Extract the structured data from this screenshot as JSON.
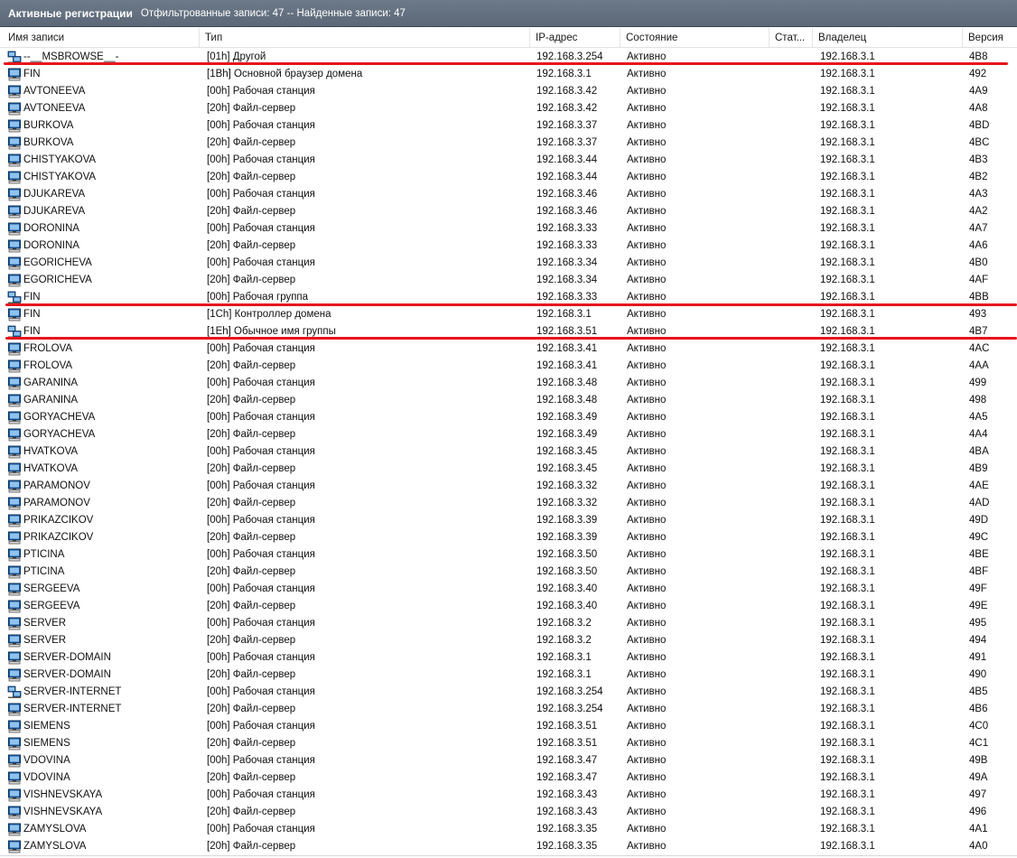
{
  "window": {
    "title": "Активные регистрации",
    "info": "Отфильтрованные записи: 47 -- Найденные записи: 47"
  },
  "columns": {
    "name": "Имя записи",
    "type": "Тип",
    "ip": "IP-адрес",
    "state": "Состояние",
    "static": "Стат...",
    "owner": "Владелец",
    "version": "Версия"
  },
  "colors": {
    "accent_line": "#e8141c",
    "header_bg": "#5f6b7a"
  },
  "rows": [
    {
      "icon": "group-icon",
      "name": "--__MSBROWSE__-",
      "type": "[01h] Другой",
      "ip": "192.168.3.254",
      "state": "Активно",
      "owner": "192.168.3.1",
      "version": "4B8"
    },
    {
      "icon": "computer-icon",
      "name": "FIN",
      "type": "[1Bh] Основной браузер домена",
      "ip": "192.168.3.1",
      "state": "Активно",
      "owner": "192.168.3.1",
      "version": "492"
    },
    {
      "icon": "computer-icon",
      "name": "AVTONEEVA",
      "type": "[00h] Рабочая станция",
      "ip": "192.168.3.42",
      "state": "Активно",
      "owner": "192.168.3.1",
      "version": "4A9"
    },
    {
      "icon": "computer-icon",
      "name": "AVTONEEVA",
      "type": "[20h] Файл-сервер",
      "ip": "192.168.3.42",
      "state": "Активно",
      "owner": "192.168.3.1",
      "version": "4A8"
    },
    {
      "icon": "computer-icon",
      "name": "BURKOVA",
      "type": "[00h] Рабочая станция",
      "ip": "192.168.3.37",
      "state": "Активно",
      "owner": "192.168.3.1",
      "version": "4BD"
    },
    {
      "icon": "computer-icon",
      "name": "BURKOVA",
      "type": "[20h] Файл-сервер",
      "ip": "192.168.3.37",
      "state": "Активно",
      "owner": "192.168.3.1",
      "version": "4BC"
    },
    {
      "icon": "computer-icon",
      "name": "CHISTYAKOVA",
      "type": "[00h] Рабочая станция",
      "ip": "192.168.3.44",
      "state": "Активно",
      "owner": "192.168.3.1",
      "version": "4B3"
    },
    {
      "icon": "computer-icon",
      "name": "CHISTYAKOVA",
      "type": "[20h] Файл-сервер",
      "ip": "192.168.3.44",
      "state": "Активно",
      "owner": "192.168.3.1",
      "version": "4B2"
    },
    {
      "icon": "computer-icon",
      "name": "DJUKAREVA",
      "type": "[00h] Рабочая станция",
      "ip": "192.168.3.46",
      "state": "Активно",
      "owner": "192.168.3.1",
      "version": "4A3"
    },
    {
      "icon": "computer-icon",
      "name": "DJUKAREVA",
      "type": "[20h] Файл-сервер",
      "ip": "192.168.3.46",
      "state": "Активно",
      "owner": "192.168.3.1",
      "version": "4A2"
    },
    {
      "icon": "computer-icon",
      "name": "DORONINA",
      "type": "[00h] Рабочая станция",
      "ip": "192.168.3.33",
      "state": "Активно",
      "owner": "192.168.3.1",
      "version": "4A7"
    },
    {
      "icon": "computer-icon",
      "name": "DORONINA",
      "type": "[20h] Файл-сервер",
      "ip": "192.168.3.33",
      "state": "Активно",
      "owner": "192.168.3.1",
      "version": "4A6"
    },
    {
      "icon": "computer-icon",
      "name": "EGORICHEVA",
      "type": "[00h] Рабочая станция",
      "ip": "192.168.3.34",
      "state": "Активно",
      "owner": "192.168.3.1",
      "version": "4B0"
    },
    {
      "icon": "computer-icon",
      "name": "EGORICHEVA",
      "type": "[20h] Файл-сервер",
      "ip": "192.168.3.34",
      "state": "Активно",
      "owner": "192.168.3.1",
      "version": "4AF"
    },
    {
      "icon": "group-icon",
      "name": "FIN",
      "type": "[00h] Рабочая группа",
      "ip": "192.168.3.33",
      "state": "Активно",
      "owner": "192.168.3.1",
      "version": "4BB"
    },
    {
      "icon": "computer-icon",
      "name": "FIN",
      "type": "[1Ch] Контроллер домена",
      "ip": "192.168.3.1",
      "state": "Активно",
      "owner": "192.168.3.1",
      "version": "493"
    },
    {
      "icon": "group-icon",
      "name": "FIN",
      "type": "[1Eh] Обычное имя группы",
      "ip": "192.168.3.51",
      "state": "Активно",
      "owner": "192.168.3.1",
      "version": "4B7"
    },
    {
      "icon": "computer-icon",
      "name": "FROLOVA",
      "type": "[00h] Рабочая станция",
      "ip": "192.168.3.41",
      "state": "Активно",
      "owner": "192.168.3.1",
      "version": "4AC"
    },
    {
      "icon": "computer-icon",
      "name": "FROLOVA",
      "type": "[20h] Файл-сервер",
      "ip": "192.168.3.41",
      "state": "Активно",
      "owner": "192.168.3.1",
      "version": "4AA"
    },
    {
      "icon": "computer-icon",
      "name": "GARANINA",
      "type": "[00h] Рабочая станция",
      "ip": "192.168.3.48",
      "state": "Активно",
      "owner": "192.168.3.1",
      "version": "499"
    },
    {
      "icon": "computer-icon",
      "name": "GARANINA",
      "type": "[20h] Файл-сервер",
      "ip": "192.168.3.48",
      "state": "Активно",
      "owner": "192.168.3.1",
      "version": "498"
    },
    {
      "icon": "computer-icon",
      "name": "GORYACHEVA",
      "type": "[00h] Рабочая станция",
      "ip": "192.168.3.49",
      "state": "Активно",
      "owner": "192.168.3.1",
      "version": "4A5"
    },
    {
      "icon": "computer-icon",
      "name": "GORYACHEVA",
      "type": "[20h] Файл-сервер",
      "ip": "192.168.3.49",
      "state": "Активно",
      "owner": "192.168.3.1",
      "version": "4A4"
    },
    {
      "icon": "computer-icon",
      "name": "HVATKOVA",
      "type": "[00h] Рабочая станция",
      "ip": "192.168.3.45",
      "state": "Активно",
      "owner": "192.168.3.1",
      "version": "4BA"
    },
    {
      "icon": "computer-icon",
      "name": "HVATKOVA",
      "type": "[20h] Файл-сервер",
      "ip": "192.168.3.45",
      "state": "Активно",
      "owner": "192.168.3.1",
      "version": "4B9"
    },
    {
      "icon": "computer-icon",
      "name": "PARAMONOV",
      "type": "[00h] Рабочая станция",
      "ip": "192.168.3.32",
      "state": "Активно",
      "owner": "192.168.3.1",
      "version": "4AE"
    },
    {
      "icon": "computer-icon",
      "name": "PARAMONOV",
      "type": "[20h] Файл-сервер",
      "ip": "192.168.3.32",
      "state": "Активно",
      "owner": "192.168.3.1",
      "version": "4AD"
    },
    {
      "icon": "computer-icon",
      "name": "PRIKAZCIKOV",
      "type": "[00h] Рабочая станция",
      "ip": "192.168.3.39",
      "state": "Активно",
      "owner": "192.168.3.1",
      "version": "49D"
    },
    {
      "icon": "computer-icon",
      "name": "PRIKAZCIKOV",
      "type": "[20h] Файл-сервер",
      "ip": "192.168.3.39",
      "state": "Активно",
      "owner": "192.168.3.1",
      "version": "49C"
    },
    {
      "icon": "computer-icon",
      "name": "PTICINA",
      "type": "[00h] Рабочая станция",
      "ip": "192.168.3.50",
      "state": "Активно",
      "owner": "192.168.3.1",
      "version": "4BE"
    },
    {
      "icon": "computer-icon",
      "name": "PTICINA",
      "type": "[20h] Файл-сервер",
      "ip": "192.168.3.50",
      "state": "Активно",
      "owner": "192.168.3.1",
      "version": "4BF"
    },
    {
      "icon": "computer-icon",
      "name": "SERGEEVA",
      "type": "[00h] Рабочая станция",
      "ip": "192.168.3.40",
      "state": "Активно",
      "owner": "192.168.3.1",
      "version": "49F"
    },
    {
      "icon": "computer-icon",
      "name": "SERGEEVA",
      "type": "[20h] Файл-сервер",
      "ip": "192.168.3.40",
      "state": "Активно",
      "owner": "192.168.3.1",
      "version": "49E"
    },
    {
      "icon": "computer-icon",
      "name": "SERVER",
      "type": "[00h] Рабочая станция",
      "ip": "192.168.3.2",
      "state": "Активно",
      "owner": "192.168.3.1",
      "version": "495"
    },
    {
      "icon": "computer-icon",
      "name": "SERVER",
      "type": "[20h] Файл-сервер",
      "ip": "192.168.3.2",
      "state": "Активно",
      "owner": "192.168.3.1",
      "version": "494"
    },
    {
      "icon": "computer-icon",
      "name": "SERVER-DOMAIN",
      "type": "[00h] Рабочая станция",
      "ip": "192.168.3.1",
      "state": "Активно",
      "owner": "192.168.3.1",
      "version": "491"
    },
    {
      "icon": "computer-icon",
      "name": "SERVER-DOMAIN",
      "type": "[20h] Файл-сервер",
      "ip": "192.168.3.1",
      "state": "Активно",
      "owner": "192.168.3.1",
      "version": "490"
    },
    {
      "icon": "group-icon",
      "name": "SERVER-INTERNET",
      "type": "[00h] Рабочая станция",
      "ip": "192.168.3.254",
      "state": "Активно",
      "owner": "192.168.3.1",
      "version": "4B5"
    },
    {
      "icon": "computer-icon",
      "name": "SERVER-INTERNET",
      "type": "[20h] Файл-сервер",
      "ip": "192.168.3.254",
      "state": "Активно",
      "owner": "192.168.3.1",
      "version": "4B6"
    },
    {
      "icon": "computer-icon",
      "name": "SIEMENS",
      "type": "[00h] Рабочая станция",
      "ip": "192.168.3.51",
      "state": "Активно",
      "owner": "192.168.3.1",
      "version": "4C0"
    },
    {
      "icon": "computer-icon",
      "name": "SIEMENS",
      "type": "[20h] Файл-сервер",
      "ip": "192.168.3.51",
      "state": "Активно",
      "owner": "192.168.3.1",
      "version": "4C1"
    },
    {
      "icon": "computer-icon",
      "name": "VDOVINA",
      "type": "[00h] Рабочая станция",
      "ip": "192.168.3.47",
      "state": "Активно",
      "owner": "192.168.3.1",
      "version": "49B"
    },
    {
      "icon": "computer-icon",
      "name": "VDOVINA",
      "type": "[20h] Файл-сервер",
      "ip": "192.168.3.47",
      "state": "Активно",
      "owner": "192.168.3.1",
      "version": "49A"
    },
    {
      "icon": "computer-icon",
      "name": "VISHNEVSKAYA",
      "type": "[00h] Рабочая станция",
      "ip": "192.168.3.43",
      "state": "Активно",
      "owner": "192.168.3.1",
      "version": "497"
    },
    {
      "icon": "computer-icon",
      "name": "VISHNEVSKAYA",
      "type": "[20h] Файл-сервер",
      "ip": "192.168.3.43",
      "state": "Активно",
      "owner": "192.168.3.1",
      "version": "496"
    },
    {
      "icon": "computer-icon",
      "name": "ZAMYSLOVA",
      "type": "[00h] Рабочая станция",
      "ip": "192.168.3.35",
      "state": "Активно",
      "owner": "192.168.3.1",
      "version": "4A1"
    },
    {
      "icon": "computer-icon",
      "name": "ZAMYSLOVA",
      "type": "[20h] Файл-сервер",
      "ip": "192.168.3.35",
      "state": "Активно",
      "owner": "192.168.3.1",
      "version": "4A0"
    }
  ]
}
